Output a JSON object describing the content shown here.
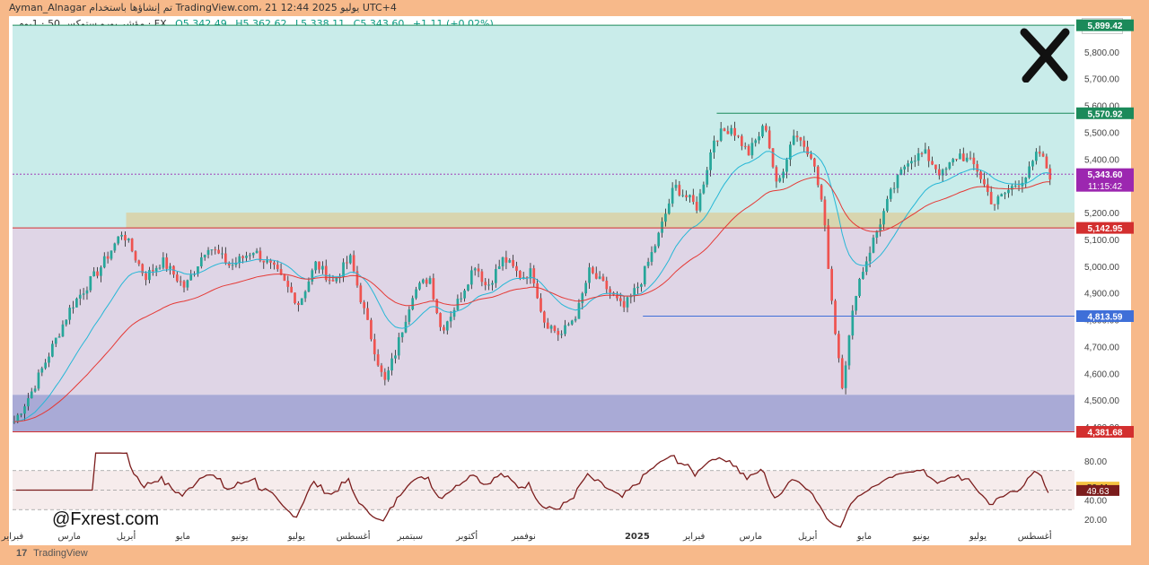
{
  "header": {
    "title_line": "Ayman_Alnagar تم إنشاؤها باستخدام TradingView.com، 21 يوليو 2025 12:44 UTC+4",
    "symbol": "مؤشر يورو ستوكس 50 · 1يوم · FX",
    "open": "O5,342.49",
    "high": "H5,362.62",
    "low": "L5,338.11",
    "close": "C5,343.60",
    "change": "+1.11 (+0.02%)",
    "currency": "EUR"
  },
  "branding": {
    "watermark": "@Fxrest.com",
    "platform": "TradingView",
    "platform_logo": "17"
  },
  "colors": {
    "up": "#26a69a",
    "down": "#ef5350",
    "ema_fast": "#26b7d6",
    "ema_slow": "#e53935",
    "rsi": "#7b1c1c",
    "zone_top": "#c9ecea",
    "zone_mid": "#dfd5e6",
    "zone_low": "#a9aad6",
    "supply_zone": "#dcd0a0",
    "green_label": "#1b8a5a",
    "red_label": "#d32f2f",
    "blue_label": "#3f6fd8",
    "purple_label": "#9c27b0"
  },
  "chart_data": [
    {
      "type": "candlestick",
      "title": "",
      "ylim": [
        4380,
        5900
      ],
      "y_ticks": [
        "4,400.00",
        "4,500.00",
        "4,600.00",
        "4,700.00",
        "4,800.00",
        "4,900.00",
        "5,000.00",
        "5,100.00",
        "5,200.00",
        "5,300.00",
        "5,400.00",
        "5,500.00",
        "5,600.00",
        "5,700.00",
        "5,800.00"
      ],
      "x_ticks": [
        "فبراير",
        "مارس",
        "أبريل",
        "مايو",
        "يونيو",
        "يوليو",
        "أغسطس",
        "سبتمبر",
        "أكتوبر",
        "نوفمبر",
        "2025",
        "فبراير",
        "مارس",
        "أبريل",
        "مايو",
        "يونيو",
        "يوليو",
        "أغسطس"
      ],
      "x_tick_months": [
        0,
        1,
        2,
        3,
        4,
        5,
        6,
        7,
        8,
        9,
        11,
        12,
        13,
        14,
        15,
        16,
        17,
        18
      ],
      "months_span": 18.7,
      "keypoints": [
        [
          0,
          4420
        ],
        [
          0.3,
          4530
        ],
        [
          1,
          4850
        ],
        [
          1.5,
          4990
        ],
        [
          1.9,
          5130
        ],
        [
          2.3,
          4960
        ],
        [
          2.6,
          5020
        ],
        [
          3,
          4920
        ],
        [
          3.4,
          5080
        ],
        [
          3.8,
          5000
        ],
        [
          4.2,
          5060
        ],
        [
          4.6,
          4980
        ],
        [
          5,
          4860
        ],
        [
          5.3,
          5010
        ],
        [
          5.6,
          4940
        ],
        [
          5.9,
          5030
        ],
        [
          6.2,
          4790
        ],
        [
          6.5,
          4560
        ],
        [
          6.7,
          4680
        ],
        [
          7,
          4900
        ],
        [
          7.3,
          4960
        ],
        [
          7.5,
          4760
        ],
        [
          7.8,
          4870
        ],
        [
          8.1,
          5010
        ],
        [
          8.3,
          4920
        ],
        [
          8.6,
          5030
        ],
        [
          8.9,
          4960
        ],
        [
          9.1,
          4980
        ],
        [
          9.3,
          4800
        ],
        [
          9.6,
          4740
        ],
        [
          9.9,
          4830
        ],
        [
          10.1,
          4980
        ],
        [
          10.4,
          4920
        ],
        [
          10.7,
          4840
        ],
        [
          11,
          4940
        ],
        [
          11.3,
          5100
        ],
        [
          11.6,
          5300
        ],
        [
          12,
          5220
        ],
        [
          12.3,
          5480
        ],
        [
          12.6,
          5520
        ],
        [
          12.9,
          5420
        ],
        [
          13.2,
          5530
        ],
        [
          13.4,
          5290
        ],
        [
          13.7,
          5500
        ],
        [
          14,
          5420
        ],
        [
          14.2,
          5230
        ],
        [
          14.4,
          4800
        ],
        [
          14.55,
          4560
        ],
        [
          14.8,
          4920
        ],
        [
          15.1,
          5100
        ],
        [
          15.4,
          5270
        ],
        [
          15.7,
          5400
        ],
        [
          16,
          5420
        ],
        [
          16.3,
          5340
        ],
        [
          16.6,
          5420
        ],
        [
          16.9,
          5370
        ],
        [
          17.2,
          5230
        ],
        [
          17.5,
          5290
        ],
        [
          17.8,
          5340
        ],
        [
          18,
          5430
        ],
        [
          18.2,
          5340
        ]
      ],
      "highlights": [
        {
          "level": 5899.42,
          "label": "5,899.42",
          "kind": "green_line"
        },
        {
          "level": 5570.92,
          "label": "5,570.92",
          "kind": "green_line"
        },
        {
          "level": 5343.6,
          "label": "5,343.60",
          "sublabel": "11:15:42",
          "kind": "current"
        },
        {
          "level": 5142.95,
          "label": "5,142.95",
          "kind": "red_line"
        },
        {
          "level": 4813.59,
          "label": "4,813.59",
          "kind": "blue_line"
        },
        {
          "level": 4381.68,
          "label": "4,381.68",
          "kind": "red_line"
        }
      ]
    },
    {
      "type": "line",
      "title": "",
      "ylim": [
        10,
        90
      ],
      "y_ticks": [
        "80.00",
        "40.00",
        "20.00"
      ],
      "current_values": [
        "53.11",
        "49.63"
      ],
      "levels": [
        70,
        50,
        30
      ]
    }
  ]
}
